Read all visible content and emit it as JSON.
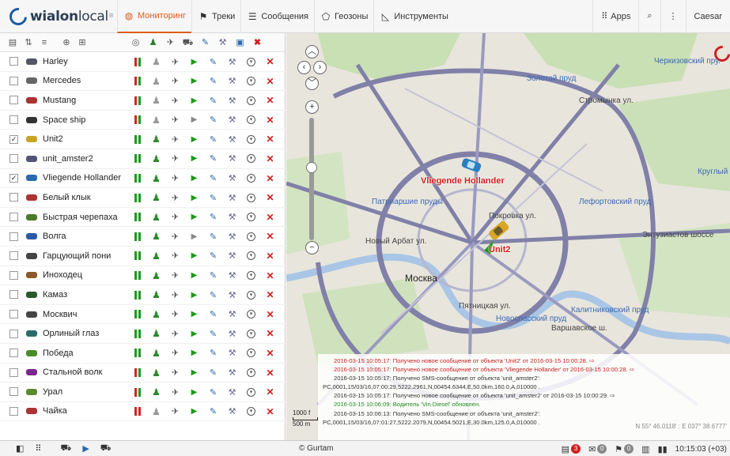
{
  "app": {
    "logo_text": "wialon",
    "logo_text2": "local",
    "logo_sup": "®"
  },
  "nav": [
    {
      "label": "Мониторинг",
      "icon": "globe-icon",
      "active": true
    },
    {
      "label": "Треки",
      "icon": "flag-icon"
    },
    {
      "label": "Сообщения",
      "icon": "list-icon"
    },
    {
      "label": "Геозоны",
      "icon": "geofence-icon"
    },
    {
      "label": "Инструменты",
      "icon": "chart-icon"
    }
  ],
  "topright": {
    "apps": "Apps",
    "user": "Caesar"
  },
  "units": [
    {
      "name": "Harley",
      "checked": false,
      "batt": "rg",
      "man_on": false,
      "play_on": true
    },
    {
      "name": "Mercedes",
      "checked": false,
      "batt": "rg",
      "man_on": false,
      "play_on": true
    },
    {
      "name": "Mustang",
      "checked": false,
      "batt": "rg",
      "man_on": false,
      "play_on": true
    },
    {
      "name": "Space ship",
      "checked": false,
      "batt": "rg",
      "man_on": false,
      "play_on": false
    },
    {
      "name": "Unit2",
      "checked": true,
      "batt": "gg",
      "man_on": true,
      "play_on": true
    },
    {
      "name": "unit_amster2",
      "checked": false,
      "batt": "gg",
      "man_on": true,
      "play_on": true
    },
    {
      "name": "Vliegende Hollander",
      "checked": true,
      "batt": "gg",
      "man_on": true,
      "play_on": true
    },
    {
      "name": "Белый клык",
      "checked": false,
      "batt": "gg",
      "man_on": true,
      "play_on": true
    },
    {
      "name": "Быстрая черепаха",
      "checked": false,
      "batt": "gg",
      "man_on": true,
      "play_on": true
    },
    {
      "name": "Волга",
      "checked": false,
      "batt": "gg",
      "man_on": true,
      "play_on": false
    },
    {
      "name": "Гарцующий пони",
      "checked": false,
      "batt": "gg",
      "man_on": true,
      "play_on": true
    },
    {
      "name": "Иноходец",
      "checked": false,
      "batt": "gg",
      "man_on": true,
      "play_on": true
    },
    {
      "name": "Камаз",
      "checked": false,
      "batt": "gg",
      "man_on": true,
      "play_on": true
    },
    {
      "name": "Москвич",
      "checked": false,
      "batt": "gg",
      "man_on": true,
      "play_on": true
    },
    {
      "name": "Орлиный глаз",
      "checked": false,
      "batt": "gg",
      "man_on": true,
      "play_on": true
    },
    {
      "name": "Победа",
      "checked": false,
      "batt": "gg",
      "man_on": true,
      "play_on": true
    },
    {
      "name": "Стальной волк",
      "checked": false,
      "batt": "rg",
      "man_on": true,
      "play_on": true
    },
    {
      "name": "Урал",
      "checked": false,
      "batt": "rg",
      "man_on": true,
      "play_on": true
    },
    {
      "name": "Чайка",
      "checked": false,
      "batt": "rr",
      "man_on": false,
      "play_on": true
    }
  ],
  "map": {
    "city_label": "Москва",
    "unit_labels": [
      "Vliegende Hollander",
      "Unit2"
    ],
    "street_labels": [
      "Золотой пруд",
      "Патриаршие пруды",
      "Новый Арбат ул.",
      "Новоспасский пруд",
      "Калитниковский пруд",
      "Лефортовский пруд",
      "Черкизовский пру.",
      "Круглый п",
      "Энтузиастов шоссе",
      "Стромынка ул.",
      "Покровка ул.",
      "Пятницкая ул.",
      "Варшавское ш."
    ],
    "scale_label": "1000 f",
    "scale_label2": "500 m",
    "coords": "N 55° 46.0118' : E 037° 38.6777'"
  },
  "log": [
    {
      "text": "2016-03-15 10:05:17: Получено новое сообщение от объекта 'Unit2' от 2016-03-15 10:00:28. ⇨",
      "style": "red"
    },
    {
      "text": "2016-03-15 10:05:17: Получено новое сообщение от объекта 'Vliegende Hollander' от 2016-03-15 10:00:28. ⇨",
      "style": "red"
    },
    {
      "text": "2016-03-15 10:05:17: Получено SMS-сообщение от объекта 'unit_amster2':",
      "style": "dark"
    },
    {
      "text": "PC,0001,15/03/16,07:00:29,5222.2961,N,00454.6344,E,50.0km,160.0,A,010000 .",
      "style": "dark"
    },
    {
      "text": "2016-03-15 10:05:17: Получено новое сообщение от объекта 'unit_amster2' от 2016-03-15 10:00:29. ⇨",
      "style": "dark"
    },
    {
      "text": "2016-03-15 10:06:09: Водитель 'Vin Diesel' обновлен.",
      "style": "green"
    },
    {
      "text": "2016-03-15 10:06:13: Получено SMS-сообщение от объекта 'unit_amster2':",
      "style": "dark"
    },
    {
      "text": "PC,0001,15/03/16,07:01:27,5222.2079,N,00454.5021,E,30.0km,125.0,A,010000 .",
      "style": "dark"
    }
  ],
  "bottom": {
    "copyright": "© Gurtam",
    "badges": [
      "3",
      "0",
      "0"
    ],
    "time": "10:15:03 (+03)"
  }
}
